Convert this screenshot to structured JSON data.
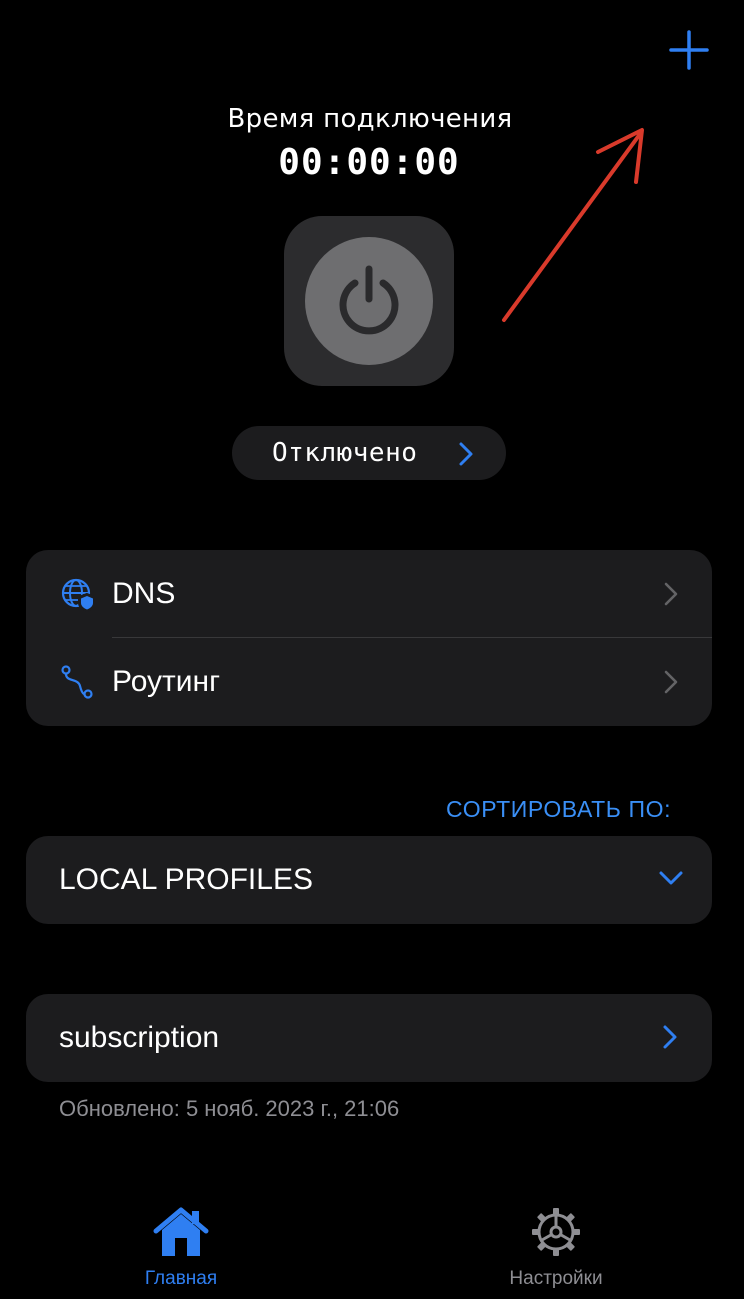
{
  "colors": {
    "accent": "#2f7ff2",
    "background": "#000000",
    "card": "#1c1c1e",
    "annotation_arrow": "#d93a2b"
  },
  "header": {
    "add_icon": "plus-icon"
  },
  "connection": {
    "label": "Время подключения",
    "timer": "00:00:00",
    "power_icon": "power-icon",
    "status": "Отключено"
  },
  "menu": {
    "items": [
      {
        "label": "DNS",
        "icon": "globe-shield-icon"
      },
      {
        "label": "Роутинг",
        "icon": "route-icon"
      }
    ]
  },
  "sort": {
    "label": "СОРТИРОВАТЬ ПО:"
  },
  "profiles": {
    "selected": "LOCAL PROFILES"
  },
  "subscription": {
    "name": "subscription",
    "updated": "Обновлено: 5 нояб. 2023 г., 21:06"
  },
  "tabbar": {
    "tabs": [
      {
        "label": "Главная",
        "icon": "home-icon",
        "active": true
      },
      {
        "label": "Настройки",
        "icon": "gear-icon",
        "active": false
      }
    ]
  }
}
